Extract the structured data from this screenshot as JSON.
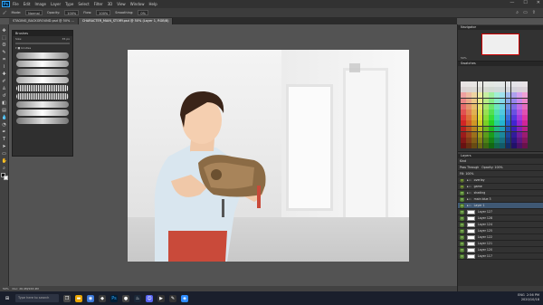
{
  "menubar": {
    "logo": "Ps",
    "items": [
      "File",
      "Edit",
      "Image",
      "Layer",
      "Type",
      "Select",
      "Filter",
      "3D",
      "View",
      "Window",
      "Help"
    ],
    "window_controls": [
      "—",
      "☐",
      "✕"
    ]
  },
  "options": {
    "mode_label": "Mode:",
    "mode_value": "Normal",
    "opacity_label": "Opacity:",
    "opacity_value": "100%",
    "flow_label": "Flow:",
    "flow_value": "100%",
    "smoothing_label": "Smoothing:",
    "smoothing_value": "0%"
  },
  "tabs": [
    {
      "label": "STAGING_BACKGROUND.psd @ 50% ...",
      "active": false
    },
    {
      "label": "CHARACTER_MAIN_STORY.psd @ 50% (Layer 1, RGB/8)",
      "active": true
    }
  ],
  "brushes": {
    "title": "Brushes",
    "size_label": "Size:",
    "size_value": "35 px",
    "folder_label": "▾ ■ bristles"
  },
  "status": {
    "zoom": "50%",
    "doc": "Doc: 26.4M/163.4M"
  },
  "navigator": {
    "title": "Navigator",
    "zoom": "50%"
  },
  "swatches": {
    "title": "Swatches"
  },
  "layers": {
    "title": "Layers",
    "kind_label": "Kind",
    "blend": "Pass Through",
    "opacity_label": "Opacity: 100%",
    "fill_label": "Fill: 100%",
    "rows": [
      {
        "name": "overlay",
        "thumb": false,
        "green": false,
        "sel": false,
        "folder": true
      },
      {
        "name": "game",
        "thumb": false,
        "green": false,
        "sel": false,
        "folder": true
      },
      {
        "name": "shading",
        "thumb": false,
        "green": true,
        "sel": false,
        "folder": true
      },
      {
        "name": "main blue 3",
        "thumb": false,
        "green": true,
        "sel": false,
        "folder": true
      },
      {
        "name": "Layer 1",
        "thumb": false,
        "green": true,
        "sel": true,
        "folder": true
      },
      {
        "name": "Layer 127",
        "thumb": true,
        "green": true,
        "sel": false,
        "folder": false
      },
      {
        "name": "Layer 128",
        "thumb": true,
        "green": true,
        "sel": false,
        "folder": false
      },
      {
        "name": "Layer 124",
        "thumb": true,
        "green": true,
        "sel": false,
        "folder": false
      },
      {
        "name": "Layer 125",
        "thumb": true,
        "green": true,
        "sel": false,
        "folder": false
      },
      {
        "name": "Layer 122",
        "thumb": true,
        "green": true,
        "sel": false,
        "folder": false
      },
      {
        "name": "Layer 121",
        "thumb": true,
        "green": true,
        "sel": false,
        "folder": false
      },
      {
        "name": "Layer 120",
        "thumb": true,
        "green": true,
        "sel": false,
        "folder": false
      },
      {
        "name": "Layer 117",
        "thumb": true,
        "green": true,
        "sel": false,
        "folder": false
      }
    ]
  },
  "taskbar": {
    "search_placeholder": "Type here to search",
    "time": "2:56 PM",
    "date": "2020/10/18",
    "lang": "ENG"
  }
}
